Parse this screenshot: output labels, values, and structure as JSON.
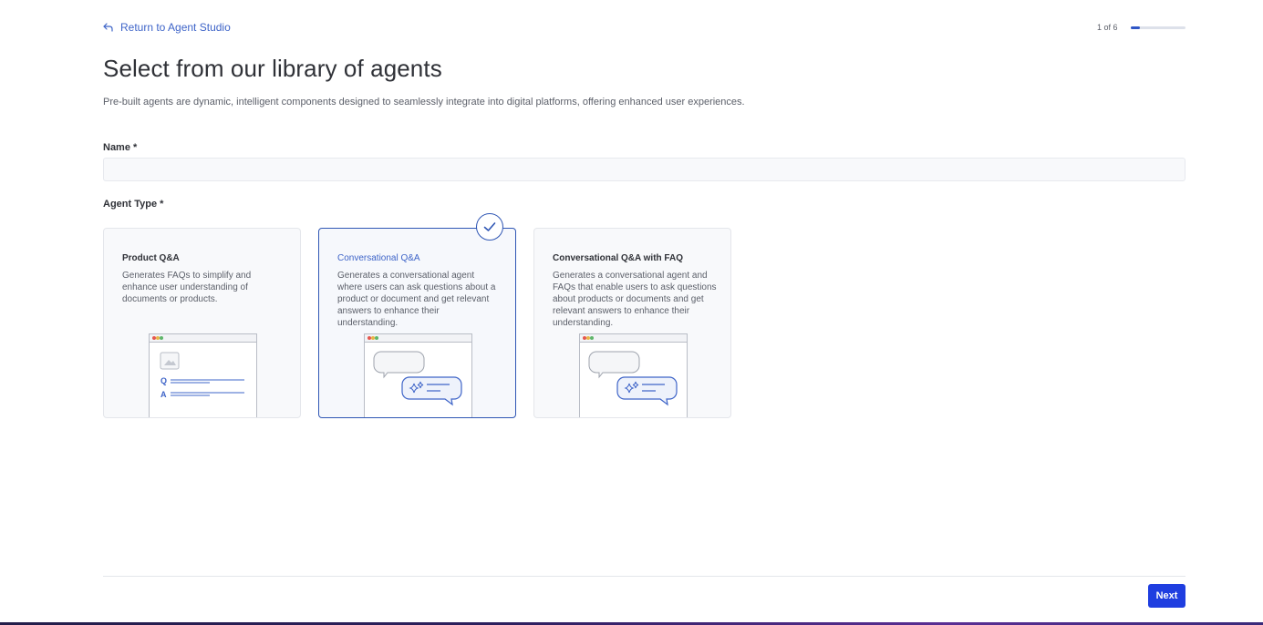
{
  "header": {
    "back_link_label": "Return to Agent Studio",
    "back_icon": "return-arrow-icon",
    "step_text": "1 of 6",
    "step_progress": 0.1667
  },
  "title": "Select from our library of agents",
  "subtitle": "Pre-built agents are dynamic, intelligent components designed to seamlessly integrate into digital platforms, offering enhanced user experiences.",
  "form": {
    "name_label": "Name *",
    "name_value": "",
    "agent_type_label": "Agent Type *"
  },
  "agent_types": [
    {
      "title": "Product Q&A",
      "description": "Generates FAQs to simplify and enhance user understanding of documents or products.",
      "selected": false,
      "illustration": "qa-page-illustration"
    },
    {
      "title": "Conversational Q&A",
      "description": "Generates a conversational agent where users can ask questions about a product or document and get relevant answers to enhance their understanding.",
      "selected": true,
      "illustration": "chat-bubbles-illustration"
    },
    {
      "title": "Conversational Q&A with FAQ",
      "description": "Generates a conversational agent and FAQs that enable users to ask questions about products or documents and get relevant answers to enhance their understanding.",
      "selected": false,
      "illustration": "chat-bubbles-illustration"
    }
  ],
  "illustration_text": {
    "q": "Q",
    "a": "A"
  },
  "footer": {
    "next_label": "Next"
  },
  "colors": {
    "accent": "#2f56b4",
    "link": "#3e64c8",
    "primary_button": "#1f3ee0"
  }
}
